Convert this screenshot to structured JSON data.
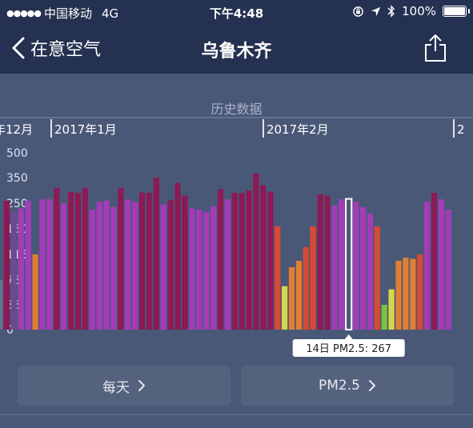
{
  "status_bar": {
    "carrier": "中国移动",
    "network": "4G",
    "time": "下午4:48",
    "battery": "100%"
  },
  "nav": {
    "back_label": "在意空气",
    "title": "乌鲁木齐"
  },
  "section_title": "历史数据",
  "buttons": {
    "period_label": "每天",
    "metric_label": "PM2.5"
  },
  "chart_data": {
    "type": "bar",
    "month_labels": [
      "年12月",
      "2017年1月",
      "2017年2月",
      "2"
    ],
    "y_tick_labels": [
      "0",
      "35",
      "75",
      "115",
      "150",
      "250",
      "350",
      "500"
    ],
    "y_tick_values": [
      0,
      35,
      75,
      115,
      150,
      250,
      350,
      500
    ],
    "values": [
      75,
      260,
      220,
      230,
      260,
      115,
      265,
      265,
      310,
      250,
      295,
      290,
      310,
      225,
      255,
      260,
      235,
      310,
      265,
      255,
      292,
      290,
      350,
      245,
      262,
      330,
      280,
      230,
      225,
      215,
      238,
      305,
      265,
      290,
      290,
      300,
      375,
      320,
      295,
      160,
      65,
      95,
      105,
      125,
      160,
      285,
      280,
      240,
      265,
      267,
      255,
      235,
      210,
      160,
      35,
      60,
      105,
      110,
      108,
      115,
      255,
      290,
      265,
      225
    ],
    "colors": [
      "#6a6f90",
      "#8b1a55",
      "#6a4a90",
      "#a43cb8",
      "#a43cb8",
      "#e07f33",
      "#a43cb8",
      "#a43cb8",
      "#8b1a55",
      "#a43cb8",
      "#8b1a55",
      "#8b1a55",
      "#8b1a55",
      "#a43cb8",
      "#a43cb8",
      "#a43cb8",
      "#a43cb8",
      "#8b1a55",
      "#a43cb8",
      "#a43cb8",
      "#8b1a55",
      "#8b1a55",
      "#8b1a55",
      "#a43cb8",
      "#8b1a55",
      "#8b1a55",
      "#8b1a55",
      "#a43cb8",
      "#a43cb8",
      "#a43cb8",
      "#a43cb8",
      "#8b1a55",
      "#a43cb8",
      "#8b1a55",
      "#8b1a55",
      "#8b1a55",
      "#8b1a55",
      "#8b1a55",
      "#8b1a55",
      "#d94a35",
      "#d6d74a",
      "#e07f33",
      "#e07f33",
      "#d94a35",
      "#d94a35",
      "#8b1a55",
      "#8b1a55",
      "#a43cb8",
      "#a43cb8",
      "#4a5878",
      "#a43cb8",
      "#a43cb8",
      "#a43cb8",
      "#d94a35",
      "#7ac243",
      "#d6d74a",
      "#e07f33",
      "#e07f33",
      "#e07f33",
      "#d94a35",
      "#a43cb8",
      "#8b1a55",
      "#a43cb8",
      "#a43cb8"
    ],
    "selected_index": 49,
    "tooltip": "14日 PM2.5: 267"
  }
}
